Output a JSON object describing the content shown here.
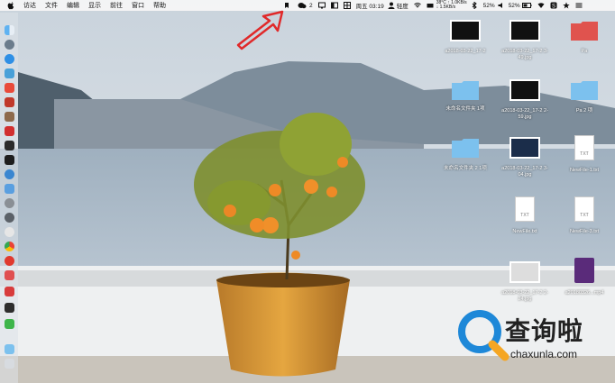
{
  "menubar": {
    "items": [
      "访达",
      "文件",
      "编辑",
      "显示",
      "前往",
      "窗口",
      "帮助"
    ],
    "wechat_count": "2",
    "clock": "周五 03:19",
    "user": "轻度",
    "temp": "38°C",
    "net_up": "↑ 1.0KB/s",
    "net_down": "↓ 1.5KB/s",
    "battery1": "52%",
    "battery2": "52%"
  },
  "desktop_items": [
    {
      "label": "a2018-03-22_17-2",
      "type": "photo"
    },
    {
      "label": "a2018-03-22_17-2 3-49.jpg",
      "type": "photo"
    },
    {
      "label": "Pa",
      "type": "folder-red"
    },
    {
      "label": "",
      "type": "folder"
    },
    {
      "label": "a2018-03-22_17-2 2-59.jpg",
      "type": "photo"
    },
    {
      "label": "Pa 2 项",
      "type": "folder"
    },
    {
      "label": "未命名文件夹 1项",
      "type": "folder"
    },
    {
      "label": "未命名文件夹 2 1项",
      "type": "folder"
    },
    {
      "label": "a2018-03-22_17-2 3-04.jpg",
      "type": "photo"
    },
    {
      "label": "NewFile-1.txt",
      "type": "txt"
    },
    {
      "label": "NewFile.txt",
      "type": "txt"
    },
    {
      "label": "NewFile-3.txt",
      "type": "txt"
    },
    {
      "label": "a2018-03-22_17-2 2-24.jpg",
      "type": "photo"
    },
    {
      "label": "a20180326...mp4",
      "type": "video"
    }
  ],
  "txt_badge": "TXT",
  "watermark": {
    "title": "查询啦",
    "url": "chaxunla.com"
  },
  "colors": {
    "folder": "#7cc1ee",
    "folder_red": "#e0534e",
    "accent_arrow": "#e0292a"
  }
}
